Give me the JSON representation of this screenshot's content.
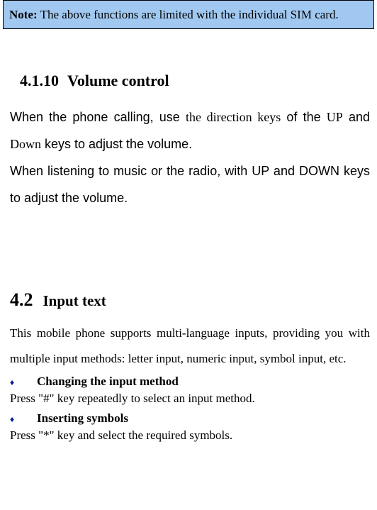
{
  "note": {
    "label": "Note:",
    "text": " The above functions are limited with the individual SIM card."
  },
  "sec4110": {
    "num": "4.1.10",
    "title": "Volume control",
    "p1_a": "When the phone calling, use ",
    "p1_b": "the direction keys",
    "p1_c": " of the ",
    "p1_d": "UP",
    "p1_e": " and ",
    "p1_f": "Down",
    "p1_g": " keys to adjust the volume.",
    "p2": "When listening to music or the radio, with UP and DOWN keys to adjust the volume."
  },
  "sec42": {
    "num": "4.2",
    "title": "Input text",
    "intro": "This mobile phone supports multi-language inputs, providing you with multiple input methods: letter input, numeric input, symbol input, etc.",
    "bullet1": "Changing the input method",
    "instr1": "Press \"#\" key repeatedly to select an input method.",
    "bullet2": "Inserting symbols",
    "instr2": "Press \"*\" key and select the required symbols."
  },
  "marker": "♦"
}
